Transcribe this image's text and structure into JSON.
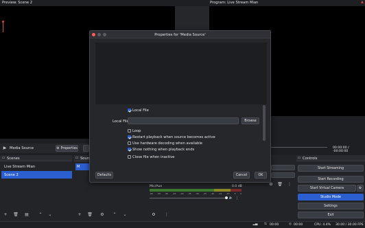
{
  "preview": {
    "title": "Preview: Scene 2"
  },
  "program": {
    "title": "Program: Live Stream Mian"
  },
  "source_bar": {
    "source_name": "Media Source",
    "properties_label": "Properties"
  },
  "timeline": {
    "time": "00:00:00 / -00:00:00"
  },
  "scenes": {
    "title": "Scenes",
    "items": [
      "Live Stream Mian",
      "Scene 2"
    ],
    "selected": 1
  },
  "sources": {
    "title": "Sourc",
    "item_prefix": "M"
  },
  "mixer": {
    "track": "Mic/Aux",
    "db": "0.0 dB",
    "ticks": [
      "-60",
      "-55",
      "-50",
      "-45",
      "-40",
      "-35",
      "-30",
      "-25",
      "-20",
      "-15",
      "-10",
      "-5",
      "0"
    ]
  },
  "controls": {
    "title": "Controls",
    "start_streaming": "Start Streaming",
    "start_recording": "Start Recording",
    "start_virtual_camera": "Start Virtual Camera",
    "studio_mode": "Studio Mode",
    "settings": "Settings",
    "exit": "Exit"
  },
  "status": {
    "stream_time": "00:00",
    "rec_time": "00:00",
    "cpu": "CPU: 4.4%",
    "fps": "30.00 / 30.00 FPS"
  },
  "dialog": {
    "title": "Properties for 'Media Source'",
    "local_file_checkbox": "Local File",
    "local_file_label": "Local File",
    "local_file_value": "",
    "browse": "Browse",
    "loop": "Loop",
    "restart": "Restart playback when source becomes active",
    "hw_decoding": "Use hardware decoding when available",
    "show_nothing": "Show nothing when playback ends",
    "close_file": "Close file when inactive",
    "defaults": "Defaults",
    "cancel": "Cancel",
    "ok": "OK"
  },
  "colors": {
    "accent": "#2b5fd0",
    "background": "#1e1f22",
    "record_marker": "#e04343"
  }
}
